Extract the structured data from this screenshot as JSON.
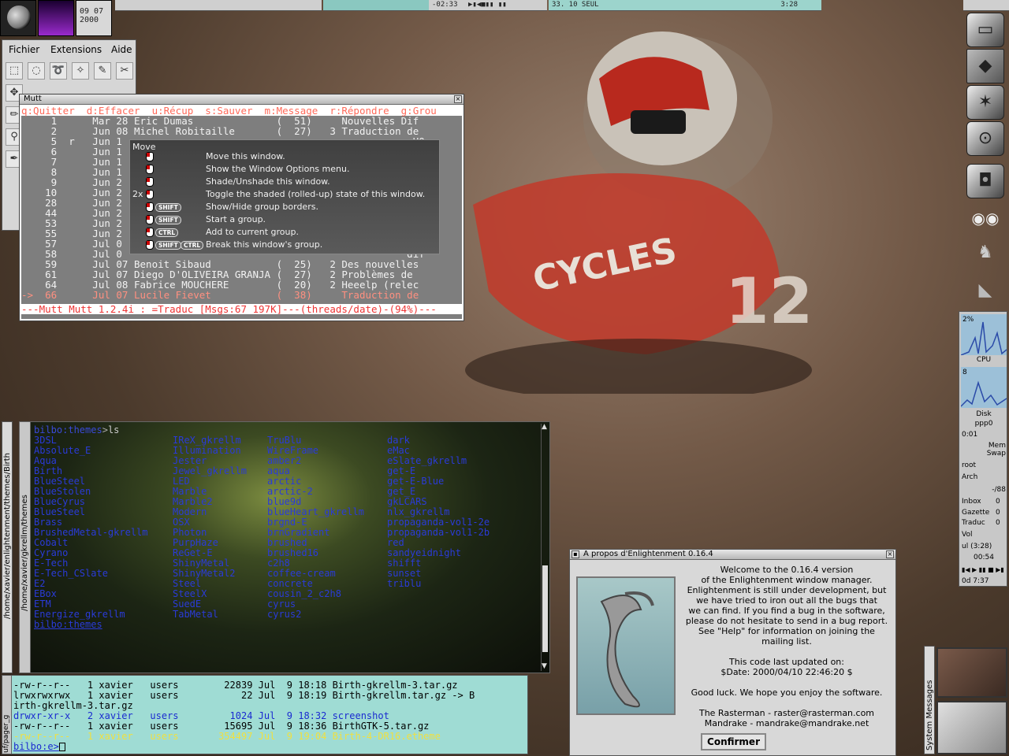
{
  "pager": {
    "clock": "09 07\n2000",
    "desk_segment": "-02:33",
    "status_mid": "33. 10 SEUL",
    "status_right": "3:28"
  },
  "gimp": {
    "menu": [
      "Fichier",
      "Extensions",
      "Aide"
    ]
  },
  "mutt": {
    "title": "Mutt",
    "help_line": "q:Quitter  d:Effacer  u:Récup  s:Sauver  m:Message  r:Répondre  g:Grou",
    "rows": [
      "     1      Mar 28 Eric Dumas              (  51)     Nouvelles Dif",
      "     2      Jun 08 Michel Robitaille       (  27)   3 Traduction de",
      "     5  r   Jun 1                                                -HO",
      "     6      Jun 1                                                NEX",
      "     7      Jun 1                                                J C",
      "     8      Jun 1                                                e po",
      "     9      Jun 2                                                d ",
      "    10      Jun 2                                                locu",
      "    28      Jun 2                                                tra",
      "    44      Jun 2                                                ils",
      "    53      Jun 2                                                uct",
      "    55      Jun 2                                                Sof",
      "    57      Jul 0                                                US",
      "    58      Jul 0                                                dif",
      "    59      Jul 07 Benoit Sibaud           (  25)   2 Des nouvelles",
      "    61      Jul 07 Diego D'OLIVEIRA GRANJA (  27)   2 Problèmes de",
      "    64      Jul 08 Fabrice MOUCHERE        (  20)   2 Heeelp (relec",
      "->  66      Jul 07 Lucile Fievet           (  38)     Traduction de"
    ],
    "status_line": "---Mutt Mutt 1.2.4i : =Traduc [Msgs:67 197K]---(threads/date)-(94%)---"
  },
  "popup": {
    "title": "Move",
    "multiplier": "2x",
    "items": [
      "Move this window.",
      "Show the Window Options menu.",
      "Shade/Unshade this window.",
      "Toggle the shaded (rolled-up) state of this window.",
      "Show/Hide group borders.",
      "Start a group.",
      "Add to current group.",
      "Break this window's group."
    ],
    "keys": {
      "shift": "SHIFT",
      "ctrl": "CTRL"
    }
  },
  "term": {
    "prompt_host": "bilbo",
    "prompt_path": ":themes",
    "prompt_cmd": "ls",
    "col1": "3DSL\nAbsolute_E\nAqua\nBirth\nBlueSteel\nBlueStolen\nBlueCyrus\nBlueSteel\nBrass\nBrushedMetal-gkrellm\nCobalt\nCyrano\nE-Tech\nE-Tech_CSlate\nE2\nEBox\nETM\nEnergize_gkrellm",
    "col2": "IReX_gkrellm\nIllumination\nJester\nJewel_gkrellm\nLED\nMarble\nMarble2\nModern\nOSX\nPhoton\nPurpHaze\nReGet-E\nShinyMetal\nShinyMetal2\nSteel\nSteelX\nSuedE\nTabMetal",
    "col3": "TruBlu\nWireFrame\namber2\naqua\narctic\narctic-2\nblue9d\nblueHeart_gkrellm\nbrgnd-E\nbrnGradient\nbrushed\nbrushed16\nc2h8\ncoffee-cream\nconcrete\ncousin_2_c2h8\ncyrus\ncyrus2",
    "col4": "dark\neMac\neSlate_gkrellm\nget-E\nget-E-Blue\nget_E\ngkLCARS\nnlx_gkrellm\npropaganda-vol1-2e\npropaganda-vol1-2b\nred\nsandyeidnight\nshifft\nsunset\ntriblu",
    "last_prompt": "bilbo:themes",
    "side_label": "/home/xavier/enlightenment/themes/Birth",
    "side_label2": "/home/xavier/gkrellm/themes"
  },
  "ls": {
    "rows": [
      "-rw-r--r--   1 xavier   users        22839 Jul  9 18:18 Birth-gkrellm-3.tar.gz",
      "lrwxrwxrwx   1 xavier   users           22 Jul  9 18:19 Birth-gkrellm.tar.gz -> B",
      "irth-gkrellm-3.tar.gz",
      "drwxr-xr-x   2 xavier   users         1024 Jul  9 18:32 screenshot",
      "-rw-r--r--   1 xavier   users        15695 Jul  9 18:36 BirthGTK-5.tar.gz",
      "-rw-r--r--   1 xavier   users       354497 Jul  9 19:04 Birth-4-DR16.etheme"
    ],
    "prompt": "bilbo:e>",
    "side_label": "uf/pager_g"
  },
  "about": {
    "title": "A propos d'Enlightenment 0.16.4",
    "lines": [
      "Welcome to the 0.16.4 version",
      "of the Enlightenment window manager.",
      "Enlightenment is still under development, but",
      "we have tried to iron out all the bugs that",
      "we can find. If you find a bug in the software,",
      "please do not hesitate to send in a bug report.",
      "See \"Help\" for information on joining the",
      "mailing list.",
      "",
      "This code last updated on:",
      "$Date: 2000/04/10 22:46:20 $",
      "",
      "Good luck. We hope you enjoy the software.",
      "",
      "The Rasterman - raster@rasterman.com",
      "Mandrake - mandrake@mandrake.net"
    ],
    "confirm": "Confirmer"
  },
  "gkrellm": {
    "cpu_pct": "2%",
    "cpu_label": "CPU",
    "disk_val": "8",
    "disk_label": "Disk",
    "net_label": "ppp0",
    "net_time": "0:01",
    "mem": "Mem",
    "swap": "Swap",
    "fs1": "root",
    "fs2": "Arch",
    "temp": "-/88",
    "mail1": "Inbox",
    "mail1_n": "0",
    "mail2": "Gazette",
    "mail2_n": "0",
    "mail3": "Traduc",
    "mail3_n": "0",
    "vol": "Vol",
    "track": "ul (3:28)",
    "time": "00:54",
    "uptime": "0d  7:37"
  },
  "system_messages": "System Messages"
}
